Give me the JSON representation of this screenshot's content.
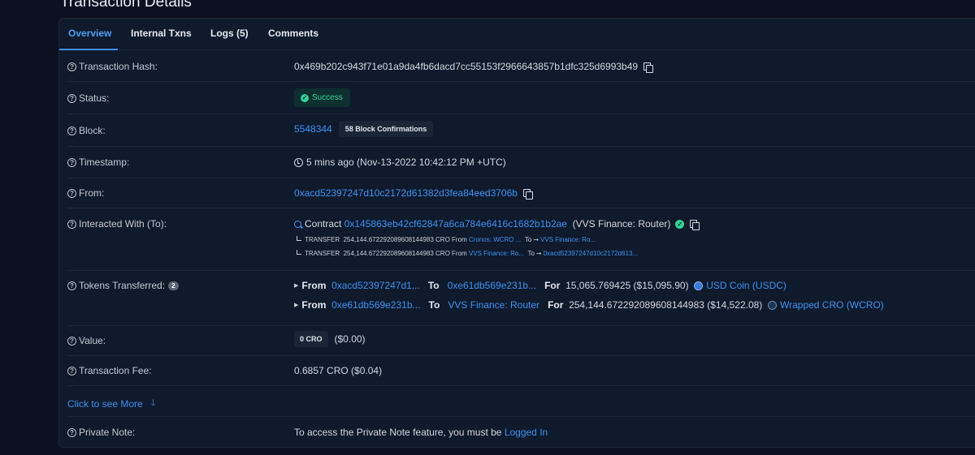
{
  "page": {
    "title": "Transaction Details"
  },
  "tabs": [
    {
      "label": "Overview",
      "active": true
    },
    {
      "label": "Internal Txns"
    },
    {
      "label": "Logs (5)"
    },
    {
      "label": "Comments"
    }
  ],
  "fields": {
    "tx_hash": {
      "label": "Transaction Hash:",
      "value": "0x469b202c943f71e01a9da4fb6dacd7cc55153f2966643857b1dfc325d6993b49"
    },
    "status": {
      "label": "Status:",
      "value": "Success"
    },
    "block": {
      "label": "Block:",
      "number": "5548344",
      "confirmations": "58 Block Confirmations"
    },
    "timestamp": {
      "label": "Timestamp:",
      "value": "5 mins ago (Nov-13-2022 10:42:12 PM +UTC)"
    },
    "from": {
      "label": "From:",
      "value": "0xacd52397247d10c2172d61382d3fea84eed3706b"
    },
    "interacted": {
      "label": "Interacted With (To):",
      "prefix": "Contract",
      "address": "0x145863eb42cf62847a6ca784e6416c1682b1b2ae",
      "name": "(VVS Finance: Router)",
      "transfers": [
        {
          "type": "TRANSFER",
          "amount": "254,144.672292089608144983 CRO",
          "from_label": "From",
          "from": "Cronos: WCRO ...",
          "to_label": "To",
          "to": "VVS Finance: Ro..."
        },
        {
          "type": "TRANSFER",
          "amount": "254,144.672292089608144983 CRO",
          "from_label": "From",
          "from": "VVS Finance: Ro...",
          "to_label": "To",
          "to": "0xacd52397247d10c2172d613..."
        }
      ]
    },
    "tokens": {
      "label": "Tokens Transferred:",
      "count": "2",
      "rows": [
        {
          "from_label": "From",
          "from": "0xacd52397247d1...",
          "to_label": "To",
          "to": "0xe61db569e231b...",
          "for_label": "For",
          "amount": "15,065.769425 ($15,095.90)",
          "token": "USD Coin (USDC)"
        },
        {
          "from_label": "From",
          "from": "0xe61db569e231b...",
          "to_label": "To",
          "to": "VVS Finance: Router",
          "for_label": "For",
          "amount": "254,144.672292089608144983 ($14,522.08)",
          "token": "Wrapped CRO (WCRO)"
        }
      ]
    },
    "value": {
      "label": "Value:",
      "amount": "0 CRO",
      "usd": "($0.00)"
    },
    "fee": {
      "label": "Transaction Fee:",
      "value": "0.6857 CRO ($0.04)"
    },
    "more": {
      "label": "Click to see More",
      "icon": "arrow-down-icon"
    },
    "note": {
      "label": "Private Note:",
      "text": "To access the Private Note feature, you must be",
      "link": "Logged In"
    }
  },
  "colors": {
    "accent": "#3d93ef",
    "success": "#2fd196",
    "background": "#0b1121",
    "card": "#0f1a2d"
  }
}
